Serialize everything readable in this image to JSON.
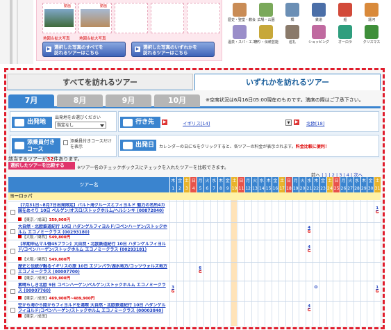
{
  "photos": [
    {
      "tag": "動画",
      "caption": "地図＆拡大写真"
    },
    {
      "tag": "動画",
      "caption": "地図＆拡大写真"
    }
  ],
  "action_buttons": [
    {
      "line1": "選択した写真のすべてを",
      "line2": "訪れるツアーはこちら"
    },
    {
      "line1": "選択した写真のいずれかを",
      "line2": "訪れるツアーはこちら"
    }
  ],
  "categories": [
    "歴史・聖堂・教会",
    "広場・公園",
    "橋",
    "鉄道",
    "船",
    "運河",
    "温泉・スパ・エステ",
    "祭り・伝統芸能",
    "巡礼",
    "ショッピング",
    "オーロラ",
    "クリスマス"
  ],
  "tabs": {
    "all": "すべてを訪れるツアー",
    "any": "いずれかを訪れるツアー"
  },
  "months": [
    "7月",
    "8月",
    "9月",
    "10月"
  ],
  "availability_note": "※空席状況は6月16日05:00現在のものです。満席の際はご了承下さい。",
  "filter": {
    "departure_label": "出発地",
    "departure_hint": "出発地をお選びください",
    "departure_value": "指定なし",
    "destination_label": "行き先",
    "destinations": [
      {
        "name": "イギリス",
        "count": "[14]"
      },
      {
        "name": "北欧",
        "count": "[18]"
      }
    ],
    "escort_label": "添乗員付き コース",
    "escort_check": "添乗員付きコースだけを表示",
    "date_label": "出発日",
    "date_note": "カレンダーの日にちをクリックすると、各ツアーの料金が表示されます。",
    "date_note_red": "料金比較に便利！"
  },
  "result": {
    "prefix": "該当するツアーが",
    "count": "32",
    "suffix": "件あります。"
  },
  "compare_button": "選択したツアーを比較する",
  "compare_note": "※ツアー名のチェックボックスにチェックを入れたツアーを比較できます。",
  "pager": {
    "prev": "前へ",
    "pages": [
      "1",
      "2",
      "3",
      "4"
    ],
    "next": "次へ"
  },
  "table": {
    "name_header": "ツアー名",
    "weekdays": [
      "木",
      "金",
      "土",
      "日",
      "月",
      "火",
      "水",
      "木",
      "金",
      "土",
      "日",
      "月",
      "火",
      "水",
      "木",
      "金",
      "土",
      "日",
      "月",
      "火",
      "水",
      "木",
      "金",
      "土",
      "日",
      "月",
      "火",
      "水",
      "木",
      "金",
      "土"
    ],
    "days": [
      "1",
      "2",
      "3",
      "4",
      "5",
      "6",
      "7",
      "8",
      "9",
      "10",
      "11",
      "12",
      "13",
      "14",
      "15",
      "16",
      "17",
      "18",
      "19",
      "20",
      "21",
      "22",
      "23",
      "24",
      "25",
      "26",
      "27",
      "28",
      "29",
      "30",
      "31"
    ],
    "region": "ヨーロッパ",
    "rows": [
      {
        "title": "【7月31日~8月7日出発限定】バルト海クルーズとフィヨルド 魅力の名所4カ国をめぐり 10日 ベルゲン/オスロ/ストックホルム/ヘルシンキ (00872840)",
        "meta": "【東京／成田】",
        "price": "359,900円",
        "marks": [
          {
            "day": 31,
            "num": "1",
            "sym": "G"
          }
        ]
      },
      {
        "title": "大自然・北欧鉄道紀行 10日 ハダンゲルフィヨルド/コペンハーゲン/ストックホルム エコノミークラス (00293180)",
        "meta": "【大阪／関西】",
        "price": "549,800円",
        "marks": [
          {
            "day": 21,
            "num": "4",
            "sym": "G"
          }
        ]
      },
      {
        "title": "【早期申込マル得45プラン】大自然・北欧鉄道紀行 10日 ハダンゲルフィヨルド/コペンハーゲン/ストックホルム エコノミークラス (00293181)",
        "meta": "【大阪／関西】",
        "price": "549,800円",
        "marks": [
          {
            "day": 21,
            "num": "4",
            "sym": "G"
          }
        ]
      },
      {
        "title": "歴史と伝統が融るイギリスの旅 10日 エジンバラ/湖水地方/コッツウォルズ地方 エコノミークラス (00007700)",
        "meta": "【東京／成田】",
        "price": "439,800円",
        "marks": [
          {
            "day": 5,
            "num": "6",
            "sym": "G"
          }
        ]
      },
      {
        "title": "素晴らしき北欧 9日 コペンハーゲン/ベルゲン/ストックホルム エコノミークラス (00007760)",
        "meta": "【東京／成田】",
        "price": "469,900円~489,900円",
        "marks": [
          {
            "day": 1,
            "num": "3",
            "sym": "G"
          },
          {
            "day": 22,
            "num": "",
            "sym": "O"
          },
          {
            "day": 31,
            "num": "1",
            "sym": "G"
          }
        ]
      },
      {
        "title": "空から海から陸からフィヨルドを満喫 大自然・北欧鉄道紀行 10日 ハダンゲルフィヨルド/コペンハーゲン/ストックホルム エコノミークラス (00003840)",
        "meta": "【東京／成田】",
        "price": "",
        "marks": [
          {
            "day": 21,
            "num": "4",
            "sym": "G"
          }
        ]
      }
    ]
  }
}
